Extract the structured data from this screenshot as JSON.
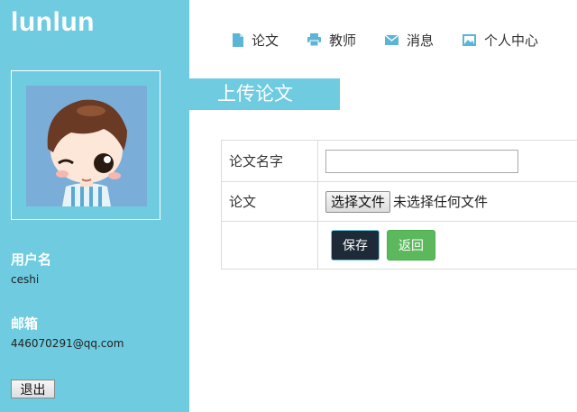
{
  "sidebar": {
    "brand": "lunlun",
    "username_label": "用户名",
    "username_value": "ceshi",
    "email_label": "邮箱",
    "email_value": "446070291@qq.com",
    "logout_label": "退出"
  },
  "nav": {
    "items": [
      {
        "label": "论文",
        "icon": "document-icon"
      },
      {
        "label": "教师",
        "icon": "printer-icon"
      },
      {
        "label": "消息",
        "icon": "envelope-icon"
      },
      {
        "label": "个人中心",
        "icon": "picture-icon"
      }
    ]
  },
  "main": {
    "section_title": "上传论文",
    "form": {
      "title_label": "论文名字",
      "title_value": "",
      "file_label": "论文",
      "file_button": "选择文件",
      "file_status": "未选择任何文件",
      "save_label": "保存",
      "back_label": "返回"
    }
  },
  "colors": {
    "accent": "#6ecbe0",
    "save_button": "#1e2a38",
    "back_button": "#5cb85c"
  }
}
